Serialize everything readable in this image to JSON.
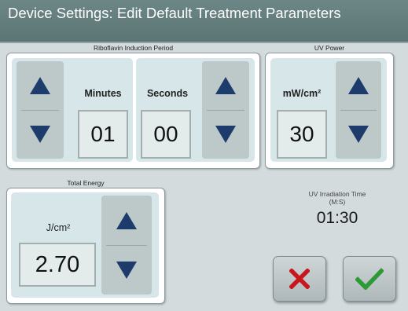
{
  "header": {
    "title": "Device Settings: Edit Default Treatment Parameters"
  },
  "riboflavin": {
    "label": "Riboflavin Induction Period",
    "minutes": {
      "unit": "Minutes",
      "value": "01"
    },
    "seconds": {
      "unit": "Seconds",
      "value": "00"
    }
  },
  "uv_power": {
    "label": "UV Power",
    "unit": "mW/cm²",
    "value": "30"
  },
  "total_energy": {
    "label": "Total Energy",
    "unit": "J/cm²",
    "value": "2.70"
  },
  "irradiation": {
    "label": "UV Irradiation Time",
    "format": "(M:S)",
    "time": "01:30"
  },
  "icons": {
    "up": "triangle-up-icon",
    "down": "triangle-down-icon",
    "cancel": "x-icon",
    "confirm": "checkmark-icon"
  },
  "colors": {
    "arrow": "#1d3c6b",
    "cancel": "#c8161d",
    "confirm": "#2f9a35",
    "titlebar": "#637c7c"
  }
}
